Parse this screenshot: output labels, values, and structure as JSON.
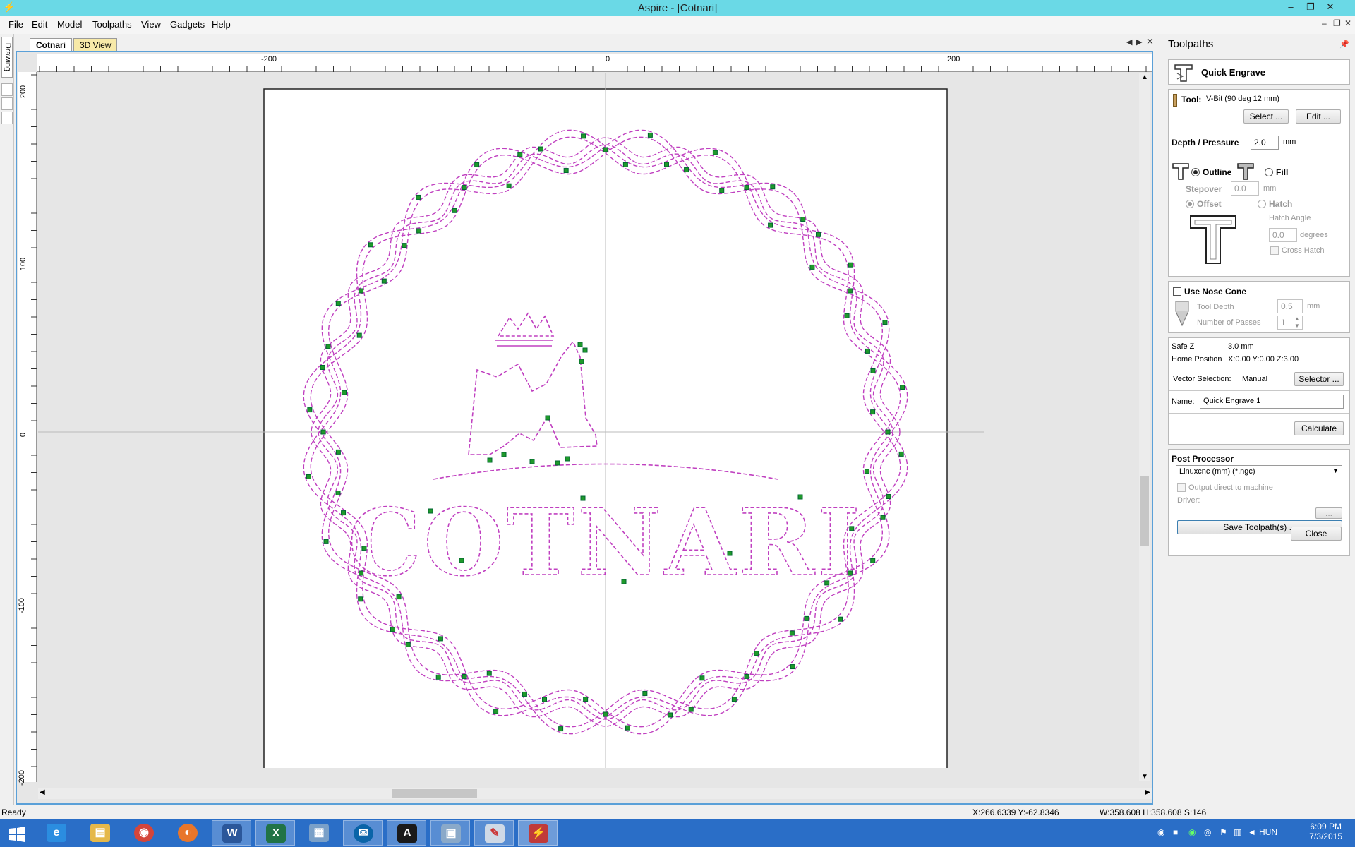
{
  "window": {
    "title": "Aspire - [Cotnari]"
  },
  "menu": [
    "File",
    "Edit",
    "Model",
    "Toolpaths",
    "View",
    "Gadgets",
    "Help"
  ],
  "left_strip": {
    "tab_label": "Drawing"
  },
  "tabs": {
    "active": "Cotnari",
    "other": "3D View"
  },
  "ruler": {
    "h_ticks": [
      "-200",
      "0",
      "200"
    ],
    "v_ticks": [
      "200",
      "100",
      "0",
      "-100",
      "-200"
    ]
  },
  "canvas": {
    "design_text": "COTNARI",
    "toolpath_color": "#c040c0",
    "node_color": "#1f9a2a"
  },
  "panel": {
    "title": "Toolpaths",
    "section_title": "Quick Engrave",
    "tool_label": "Tool:",
    "tool_value": "V-Bit (90 deg 12 mm)",
    "select_btn": "Select ...",
    "edit_btn": "Edit ...",
    "depth_label": "Depth / Pressure",
    "depth_value": "2.0",
    "depth_unit": "mm",
    "outline_label": "Outline",
    "fill_label": "Fill",
    "stepover_label": "Stepover",
    "stepover_value": "0.0",
    "stepover_unit": "mm",
    "offset_label": "Offset",
    "hatch_label": "Hatch",
    "hatch_angle_label": "Hatch Angle",
    "hatch_angle_value": "0.0",
    "degrees_label": "degrees",
    "cross_hatch_label": "Cross Hatch",
    "nose_cone_label": "Use Nose Cone",
    "tool_depth_label": "Tool Depth",
    "tool_depth_value": "0.5",
    "tool_depth_unit": "mm",
    "passes_label": "Number of Passes",
    "passes_value": "1",
    "safe_z_label": "Safe Z",
    "safe_z_value": "3.0 mm",
    "home_label": "Home Position",
    "home_value": "X:0.00 Y:0.00 Z:3.00",
    "vector_sel_label": "Vector Selection:",
    "vector_sel_value": "Manual",
    "selector_btn": "Selector ...",
    "name_label": "Name:",
    "name_value": "Quick Engrave 1",
    "calculate_btn": "Calculate",
    "post_processor_label": "Post Processor",
    "post_processor_value": "Linuxcnc (mm) (*.ngc)",
    "output_direct_label": "Output direct to machine",
    "driver_label": "Driver:",
    "driver_btn": "...",
    "save_btn": "Save Toolpath(s) ...",
    "close_btn": "Close"
  },
  "status": {
    "ready": "Ready",
    "cursor": "X:266.6339 Y:-62.8346",
    "size": "W:358.608  H:358.608  S:146"
  },
  "taskbar": {
    "apps": [
      "windows-start",
      "internet-explorer",
      "file-explorer",
      "chrome",
      "firefox",
      "word",
      "excel",
      "calculator",
      "thunderbird",
      "vcarve",
      "photo-app",
      "paint",
      "aspire"
    ],
    "tray_lang": "HUN",
    "time": "6:09 PM",
    "date": "7/3/2015"
  }
}
